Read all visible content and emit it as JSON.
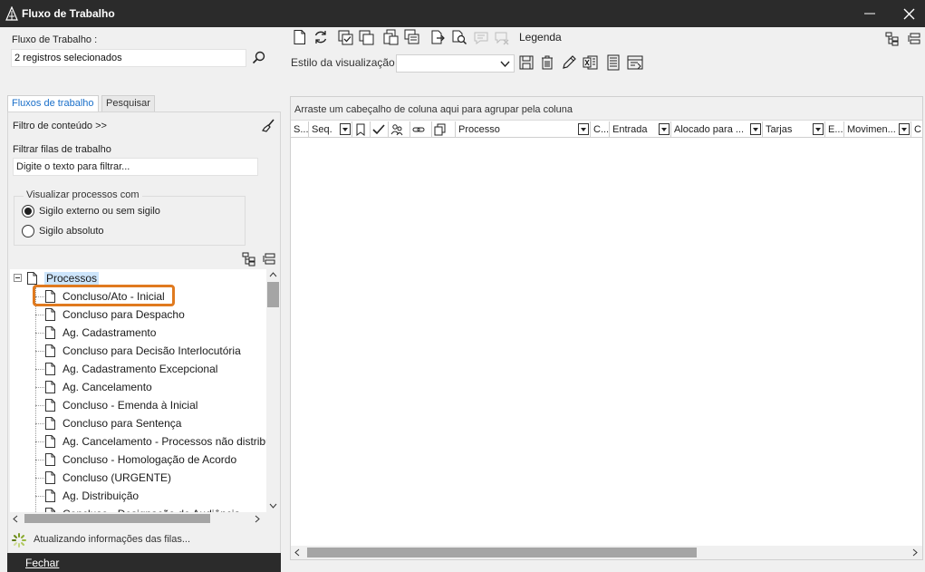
{
  "window": {
    "title": "Fluxo de Trabalho"
  },
  "left": {
    "fluxo_label": "Fluxo de Trabalho :",
    "fluxo_value": "2 registros selecionados",
    "tabs": [
      {
        "label": "Fluxos de trabalho",
        "active": true
      },
      {
        "label": "Pesquisar",
        "active": false
      }
    ],
    "filtro_conteudo": "Filtro de conteúdo >>",
    "filtrar_label": "Filtrar filas de trabalho",
    "filtrar_placeholder": "Digite o texto para filtrar...",
    "visualizar_title": "Visualizar processos com",
    "radio_externo": "Sigilo externo ou sem sigilo",
    "radio_absoluto": "Sigilo absoluto",
    "tree": {
      "root": "Processos",
      "items": [
        "Concluso/Ato - Inicial",
        "Concluso para Despacho",
        "Ag. Cadastramento",
        "Concluso para Decisão Interlocutória",
        "Ag. Cadastramento Excepcional",
        "Ag. Cancelamento",
        "Concluso - Emenda à Inicial",
        "Concluso para Sentença",
        "Ag. Cancelamento - Processos não distribu",
        "Concluso - Homologação de Acordo",
        "Concluso (URGENTE)",
        "Ag. Distribuição",
        "Concluso - Designação de Audiência"
      ]
    },
    "status_text": "Atualizando informações das filas...",
    "fechar": "Fechar"
  },
  "right": {
    "legenda": "Legenda",
    "estilo_label": "Estilo da visualização",
    "estilo_value": "",
    "group_hint": "Arraste um cabeçalho de coluna aqui para agrupar pela coluna",
    "columns": {
      "s": "S...",
      "seq": "Seq.",
      "processo": "Processo",
      "c": "C...",
      "entrada": "Entrada",
      "alocado": "Alocado para ...",
      "tarjas": "Tarjas",
      "e": "E...",
      "movimen": "Movimen...",
      "c2": "C"
    }
  },
  "colors": {
    "titlebar": "#2b2b2b",
    "selection": "#cde5fb",
    "highlight_border": "#e07a1f",
    "active_tab": "#1a6fc9"
  }
}
